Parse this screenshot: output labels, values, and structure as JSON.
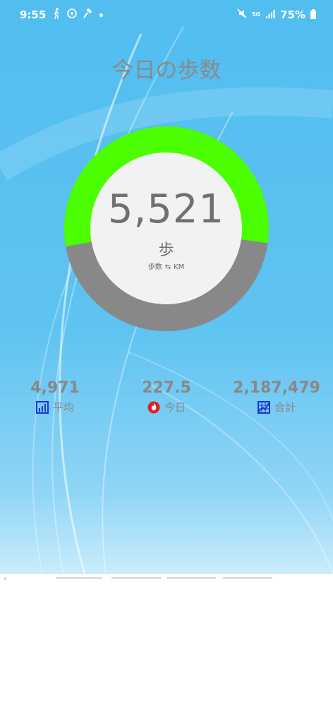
{
  "status_bar": {
    "time": "9:55",
    "network": "5G",
    "battery": "75%"
  },
  "app": {
    "title": "今日の歩数",
    "gauge": {
      "steps": "5,521",
      "unit": "歩",
      "toggle_left": "歩数",
      "toggle_right": "KM",
      "progress_fraction": 0.55,
      "filled_color": "#4cff00",
      "track_color": "#888888"
    },
    "stats": [
      {
        "value": "4,971",
        "label": "平均",
        "icon": "bar-chart-icon"
      },
      {
        "value": "227.5",
        "label": "今日",
        "icon": "flame-icon"
      },
      {
        "value": "2,187,479",
        "label": "合計",
        "icon": "grid-chart-icon"
      }
    ]
  },
  "colors": {
    "background": "#52bef0",
    "text": "#888888"
  }
}
